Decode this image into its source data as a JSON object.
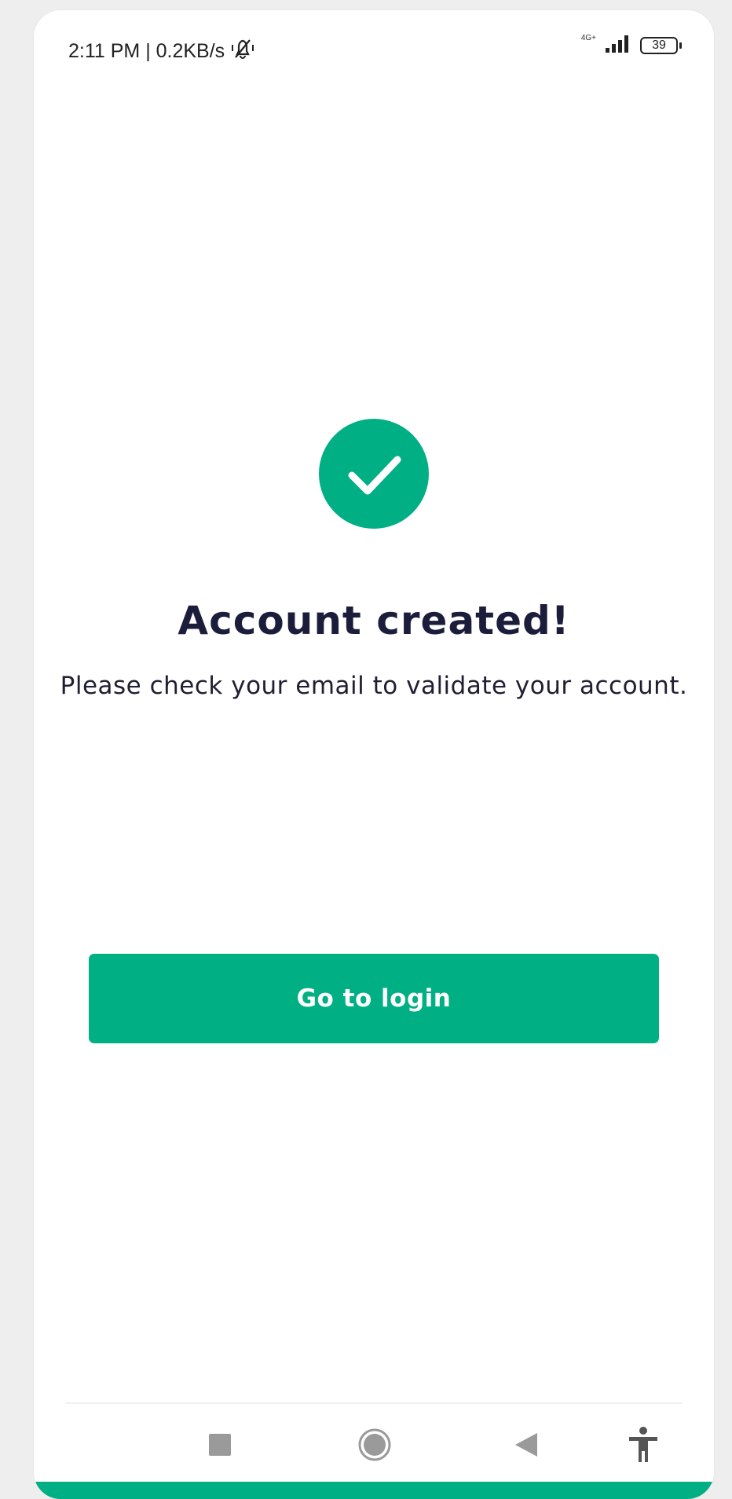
{
  "status_bar": {
    "time_speed": "2:11 PM | 0.2KB/s",
    "network": "4G+",
    "battery": "39"
  },
  "main": {
    "title": "Account created!",
    "message": "Please check your email to validate your account.",
    "login_button": "Go to login"
  },
  "nav_bar": {
    "items": [
      "recents-icon",
      "home-icon",
      "back-icon",
      "accessibility-icon"
    ]
  },
  "colors": {
    "accent": "#00af84",
    "title": "#1b1d3b"
  }
}
